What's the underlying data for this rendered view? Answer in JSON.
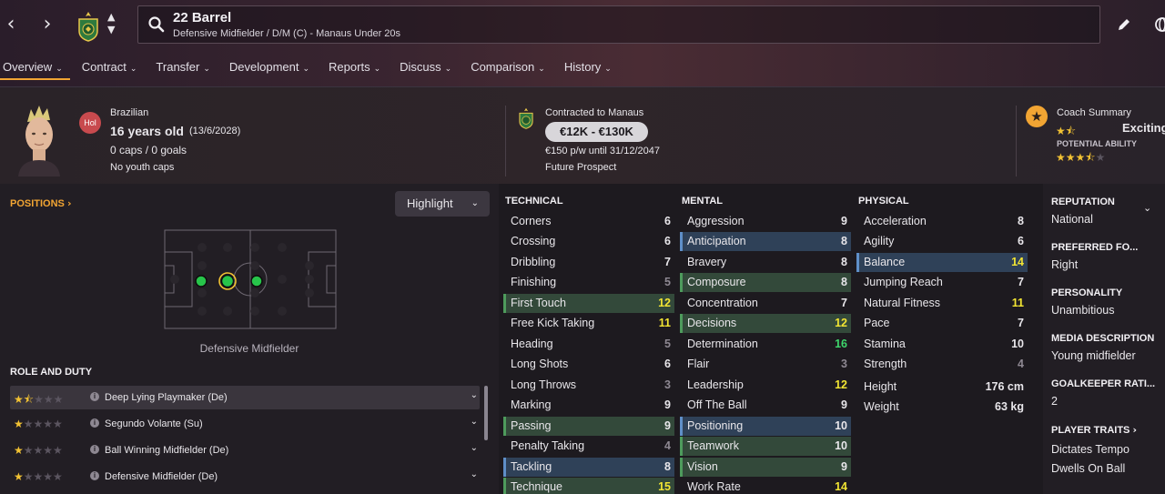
{
  "header": {
    "player_name": "22 Barrel",
    "player_subtitle": "Defensive Midfielder / D/M (C) - Manaus Under 20s"
  },
  "tabs": [
    {
      "label": "Overview"
    },
    {
      "label": "Contract"
    },
    {
      "label": "Transfer"
    },
    {
      "label": "Development"
    },
    {
      "label": "Reports"
    },
    {
      "label": "Discuss"
    },
    {
      "label": "Comparison"
    },
    {
      "label": "History"
    }
  ],
  "profile": {
    "position_badge": "Hol",
    "nationality": "Brazilian",
    "age": "16 years old",
    "dob": "(13/6/2028)",
    "caps": "0 caps / 0 goals",
    "youth_caps": "No youth caps",
    "contract_label": "Contracted to Manaus",
    "value_range": "€12K - €130K",
    "wage": "€150 p/w until 31/12/2047",
    "prospect": "Future Prospect",
    "coach_summary_label": "Coach Summary",
    "coach_summary_value": "Exciting",
    "potential_label": "POTENTIAL ABILITY",
    "current_ability_stars": 1.5,
    "potential_ability_stars": 3.5
  },
  "positions": {
    "title": "POSITIONS",
    "highlight_label": "Highlight",
    "pitch_caption": "Defensive Midfielder"
  },
  "roles": {
    "title": "ROLE AND DUTY",
    "items": [
      {
        "label": "Deep Lying Playmaker (De)",
        "stars": 1.5
      },
      {
        "label": "Segundo Volante (Su)",
        "stars": 1
      },
      {
        "label": "Ball Winning Midfielder (De)",
        "stars": 1
      },
      {
        "label": "Defensive Midfielder (De)",
        "stars": 1
      }
    ]
  },
  "technical": {
    "title": "TECHNICAL",
    "rows": [
      {
        "label": "Corners",
        "value": "6"
      },
      {
        "label": "Crossing",
        "value": "6"
      },
      {
        "label": "Dribbling",
        "value": "7"
      },
      {
        "label": "Finishing",
        "value": "5"
      },
      {
        "label": "First Touch",
        "value": "12"
      },
      {
        "label": "Free Kick Taking",
        "value": "11"
      },
      {
        "label": "Heading",
        "value": "5"
      },
      {
        "label": "Long Shots",
        "value": "6"
      },
      {
        "label": "Long Throws",
        "value": "3"
      },
      {
        "label": "Marking",
        "value": "9"
      },
      {
        "label": "Passing",
        "value": "9"
      },
      {
        "label": "Penalty Taking",
        "value": "4"
      },
      {
        "label": "Tackling",
        "value": "8"
      },
      {
        "label": "Technique",
        "value": "15"
      }
    ]
  },
  "mental": {
    "title": "MENTAL",
    "rows": [
      {
        "label": "Aggression",
        "value": "9"
      },
      {
        "label": "Anticipation",
        "value": "8"
      },
      {
        "label": "Bravery",
        "value": "8"
      },
      {
        "label": "Composure",
        "value": "8"
      },
      {
        "label": "Concentration",
        "value": "7"
      },
      {
        "label": "Decisions",
        "value": "12"
      },
      {
        "label": "Determination",
        "value": "16"
      },
      {
        "label": "Flair",
        "value": "3"
      },
      {
        "label": "Leadership",
        "value": "12"
      },
      {
        "label": "Off The Ball",
        "value": "9"
      },
      {
        "label": "Positioning",
        "value": "10"
      },
      {
        "label": "Teamwork",
        "value": "10"
      },
      {
        "label": "Vision",
        "value": "9"
      },
      {
        "label": "Work Rate",
        "value": "14"
      }
    ]
  },
  "physical": {
    "title": "PHYSICAL",
    "rows": [
      {
        "label": "Acceleration",
        "value": "8"
      },
      {
        "label": "Agility",
        "value": "6"
      },
      {
        "label": "Balance",
        "value": "14"
      },
      {
        "label": "Jumping Reach",
        "value": "7"
      },
      {
        "label": "Natural Fitness",
        "value": "11"
      },
      {
        "label": "Pace",
        "value": "7"
      },
      {
        "label": "Stamina",
        "value": "10"
      },
      {
        "label": "Strength",
        "value": "4"
      }
    ],
    "height_label": "Height",
    "height_value": "176 cm",
    "weight_label": "Weight",
    "weight_value": "63 kg"
  },
  "info": {
    "reputation_label": "REPUTATION",
    "reputation_value": "National",
    "foot_label": "PREFERRED FO...",
    "foot_value": "Right",
    "personality_label": "PERSONALITY",
    "personality_value": "Unambitious",
    "media_label": "MEDIA DESCRIPTION",
    "media_value": "Young midfielder",
    "gk_label": "GOALKEEPER RATI...",
    "gk_value": "2",
    "traits_label": "PLAYER TRAITS",
    "traits": [
      "Dictates Tempo",
      "Dwells On Ball"
    ]
  },
  "colors": {
    "accent": "#f2a533",
    "value_high": "#f2e533",
    "value_very_high": "#3ed66b",
    "value_low": "#8e8892",
    "row_green": "#33493a",
    "row_blue": "#2f4158"
  }
}
